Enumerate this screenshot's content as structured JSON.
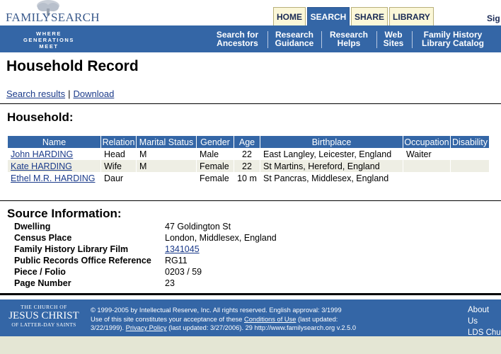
{
  "header": {
    "logo_text": "FAMILYSEARCH",
    "tabs": [
      "HOME",
      "SEARCH",
      "SHARE",
      "LIBRARY"
    ],
    "active_tab": "SEARCH",
    "signin": "Sig"
  },
  "nav": {
    "tagline_lines": [
      "WHERE",
      "GENERATIONS",
      "MEET"
    ],
    "links": [
      {
        "line1": "Search for",
        "line2": "Ancestors"
      },
      {
        "line1": "Research",
        "line2": "Guidance"
      },
      {
        "line1": "Research",
        "line2": "Helps"
      },
      {
        "line1": "Web",
        "line2": "Sites"
      },
      {
        "line1": "Family History",
        "line2": "Library Catalog"
      }
    ]
  },
  "page": {
    "title": "Household Record",
    "actions": {
      "search_results": "Search results",
      "separator": "|",
      "download": "Download"
    }
  },
  "household": {
    "heading": "Household:",
    "columns": [
      "Name",
      "Relation",
      "Marital Status",
      "Gender",
      "Age",
      "Birthplace",
      "Occupation",
      "Disability"
    ],
    "rows": [
      {
        "name": "John HARDING",
        "relation": "Head",
        "marital": "M",
        "gender": "Male",
        "age": "22",
        "birthplace": "East Langley, Leicester, England",
        "occupation": "Waiter",
        "disability": ""
      },
      {
        "name": "Kate HARDING",
        "relation": "Wife",
        "marital": "M",
        "gender": "Female",
        "age": "22",
        "birthplace": "St Martins, Hereford, England",
        "occupation": "",
        "disability": ""
      },
      {
        "name": "Ethel M.R. HARDING",
        "relation": "Daur",
        "marital": "",
        "gender": "Female",
        "age": "10 m",
        "birthplace": "St Pancras, Middlesex, England",
        "occupation": "",
        "disability": ""
      }
    ]
  },
  "source": {
    "heading": "Source Information:",
    "fields": [
      {
        "label": "Dwelling",
        "value": "47 Goldington St",
        "link": false
      },
      {
        "label": "Census Place",
        "value": "London, Middlesex, England",
        "link": false
      },
      {
        "label": "Family History Library Film",
        "value": "1341045",
        "link": true
      },
      {
        "label": "Public Records Office Reference",
        "value": "RG11",
        "link": false
      },
      {
        "label": "Piece / Folio",
        "value": "0203 / 59",
        "link": false
      },
      {
        "label": "Page Number",
        "value": "23",
        "link": false
      }
    ]
  },
  "footer": {
    "church": {
      "line1": "THE CHURCH OF",
      "line2": "JESUS CHRIST",
      "line3": "OF LATTER-DAY SAINTS"
    },
    "legal_line1": "© 1999-2005 by Intellectual Reserve, Inc.  All rights reserved.  English approval: 3/1999",
    "legal_line2_prefix": "Use of this site constitutes your acceptance of these ",
    "conditions_link": "Conditions of Use",
    "legal_line2_suffix": " (last updated:",
    "legal_line3_prefix": "3/22/1999). ",
    "privacy_link": "Privacy Policy",
    "legal_line3_suffix": " (last updated: 3/27/2006).    29    http://www.familysearch.org    v.2.5.0",
    "links": [
      "About Us",
      "LDS Chu"
    ]
  },
  "colors": {
    "brand_blue": "#3466a6",
    "tab_bg": "#fbf7d8",
    "row_alt": "#eeeee4",
    "link": "#1a3a8a"
  }
}
